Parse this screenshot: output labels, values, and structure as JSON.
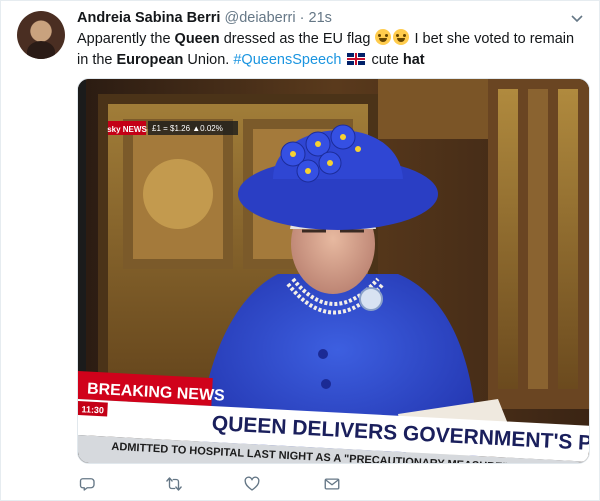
{
  "author": {
    "fullname": "Andreia Sabina Berri",
    "handle": "@deiaberri",
    "dot": "·",
    "time": "21s"
  },
  "tweet": {
    "t1": "Apparently the ",
    "t2": "Queen",
    "t3": " dressed as the EU flag ",
    "t4": " I bet she voted to remain in the ",
    "t5": "European",
    "t6": " Union.  ",
    "hashtag": "#QueensSpeech",
    "t7": " cute ",
    "t8": "hat"
  },
  "media": {
    "ticker_top": "£1 = $1.26  ▲0.02%",
    "channel_logo": "sky NEWS",
    "breaking_label": "BREAKING NEWS",
    "clock": "11:30",
    "headline": "QUEEN DELIVERS GOVERNMENT'S PL",
    "crawl": "ADMITTED TO HOSPITAL LAST NIGHT AS A \"PRECAUTIONARY MEASURE\""
  },
  "icons": {
    "caret": "chevron-down-icon",
    "reply": "reply-icon",
    "retweet": "retweet-icon",
    "like": "heart-icon",
    "dm": "envelope-icon"
  },
  "colors": {
    "link": "#1b95e0",
    "text": "#14171a",
    "muted": "#657786",
    "breaking_red": "#d0021b"
  }
}
